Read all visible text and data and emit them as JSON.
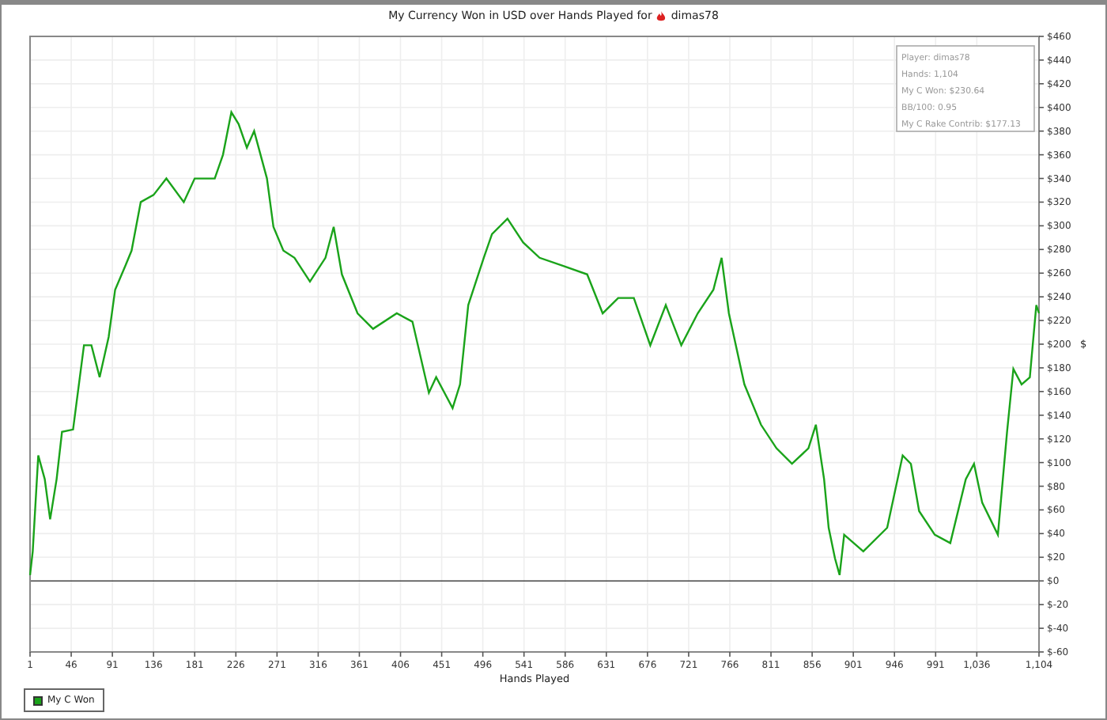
{
  "title": "My Currency Won in USD over Hands Played for",
  "player": "dimas78",
  "info_box": [
    "Player: dimas78",
    "Hands: 1,104",
    "My C Won: $230.64",
    "BB/100: 0.95",
    "My C Rake Contrib: $177.13"
  ],
  "chart_data": {
    "type": "line",
    "grid": true,
    "xlabel": "Hands Played",
    "ylabel": "$",
    "xlim": [
      1,
      1104
    ],
    "ylim": [
      -60,
      460
    ],
    "xticks": [
      1,
      46,
      91,
      136,
      181,
      226,
      271,
      316,
      361,
      406,
      451,
      496,
      541,
      586,
      631,
      676,
      721,
      766,
      811,
      856,
      901,
      946,
      991,
      {
        "value": 1036,
        "label": "1,036"
      },
      {
        "value": 1104,
        "label": "1,104"
      }
    ],
    "yticks": [
      {
        "value": 460,
        "label": "$460"
      },
      {
        "value": 440,
        "label": "$440"
      },
      {
        "value": 420,
        "label": "$420"
      },
      {
        "value": 400,
        "label": "$400"
      },
      {
        "value": 380,
        "label": "$380"
      },
      {
        "value": 360,
        "label": "$360"
      },
      {
        "value": 340,
        "label": "$340"
      },
      {
        "value": 320,
        "label": "$320"
      },
      {
        "value": 300,
        "label": "$300"
      },
      {
        "value": 280,
        "label": "$280"
      },
      {
        "value": 260,
        "label": "$260"
      },
      {
        "value": 240,
        "label": "$240"
      },
      {
        "value": 220,
        "label": "$220"
      },
      {
        "value": 200,
        "label": "$200"
      },
      {
        "value": 180,
        "label": "$180"
      },
      {
        "value": 160,
        "label": "$160"
      },
      {
        "value": 140,
        "label": "$140"
      },
      {
        "value": 120,
        "label": "$120"
      },
      {
        "value": 100,
        "label": "$100"
      },
      {
        "value": 80,
        "label": "$80"
      },
      {
        "value": 60,
        "label": "$60"
      },
      {
        "value": 40,
        "label": "$40"
      },
      {
        "value": 20,
        "label": "$20"
      },
      {
        "value": 0,
        "label": "$0"
      },
      {
        "value": -20,
        "label": "$-20"
      },
      {
        "value": -40,
        "label": "$-40"
      },
      {
        "value": -60,
        "label": "$-60"
      }
    ],
    "x": [
      1,
      4,
      10,
      17,
      23,
      30,
      36,
      48,
      60,
      68,
      77,
      87,
      94,
      105,
      112,
      122,
      136,
      150,
      169,
      181,
      203,
      212,
      221,
      229,
      238,
      246,
      260,
      267,
      278,
      290,
      307,
      324,
      333,
      342,
      359,
      376,
      402,
      419,
      437,
      445,
      463,
      471,
      480,
      497,
      506,
      523,
      540,
      558,
      584,
      610,
      627,
      644,
      661,
      679,
      696,
      713,
      731,
      748,
      757,
      765,
      782,
      800,
      817,
      834,
      852,
      860,
      869,
      874,
      881,
      886,
      891,
      912,
      938,
      955,
      964,
      973,
      990,
      1007,
      1024,
      1033,
      1042,
      1059,
      1069,
      1076,
      1085,
      1094,
      1101,
      1104
    ],
    "series": [
      {
        "name": "My C Won",
        "color": "#1aa31a",
        "values": [
          5,
          25,
          106,
          86,
          52,
          86,
          126,
          128,
          199,
          199,
          172,
          206,
          246,
          266,
          279,
          320,
          326,
          340,
          320,
          340,
          340,
          360,
          396,
          386,
          366,
          380,
          340,
          299,
          279,
          273,
          253,
          273,
          299,
          259,
          226,
          213,
          226,
          219,
          159,
          172,
          146,
          166,
          233,
          273,
          293,
          306,
          286,
          273,
          266,
          259,
          226,
          239,
          239,
          199,
          233,
          199,
          226,
          246,
          273,
          226,
          166,
          132,
          112,
          99,
          112,
          132,
          86,
          45,
          19,
          5,
          39,
          25,
          45,
          106,
          99,
          59,
          39,
          32,
          86,
          99,
          66,
          39,
          126,
          179,
          166,
          172,
          233,
          226
        ]
      }
    ]
  }
}
